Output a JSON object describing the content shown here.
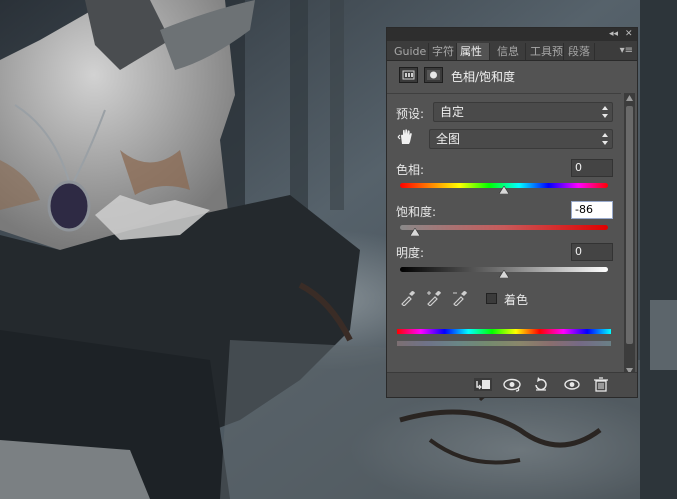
{
  "panel": {
    "titlebar": {
      "collapse_glyph": "◂◂",
      "close_glyph": "✕"
    },
    "tabs": [
      {
        "label": "Guide",
        "active": false
      },
      {
        "label": "字符",
        "active": false
      },
      {
        "label": "属性",
        "active": true
      },
      {
        "label": "信息",
        "active": false
      },
      {
        "label": "工具预",
        "active": false
      },
      {
        "label": "段落",
        "active": false
      }
    ],
    "tab_menu_glyph": "▾≡",
    "header": {
      "title": "色相/饱和度",
      "icons": [
        "adjustment-layer-icon",
        "mask-icon"
      ]
    },
    "preset": {
      "label": "预设:",
      "value": "自定"
    },
    "channel": {
      "value": "全图",
      "icon": "hand-target-icon"
    },
    "hue": {
      "label": "色相:",
      "value": "0",
      "slider_fraction": 0.5
    },
    "saturation": {
      "label": "饱和度:",
      "value": "-86",
      "slider_fraction": 0.07
    },
    "lightness": {
      "label": "明度:",
      "value": "0",
      "slider_fraction": 0.5
    },
    "eyedroppers": [
      "eyedropper-icon",
      "eyedropper-plus-icon",
      "eyedropper-minus-icon"
    ],
    "colorize": {
      "label": "着色",
      "checked": false
    },
    "footer_icons": [
      "clip-to-layer-icon",
      "view-previous-state-icon",
      "reset-icon",
      "visibility-eye-icon",
      "trash-icon"
    ]
  },
  "colors": {
    "panel_bg": "#535353",
    "tab_bar_bg": "#3c3c3c",
    "title_bar_bg": "#2e2e2e",
    "field_focus_bg": "#ffffff",
    "backdrop_tone": "#3b4248"
  }
}
